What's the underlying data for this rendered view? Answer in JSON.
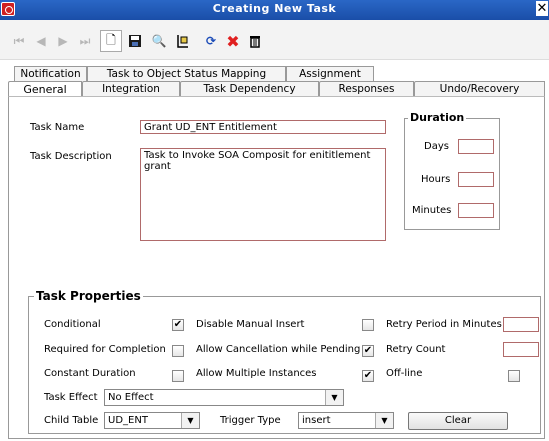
{
  "window": {
    "title": "Creating New Task",
    "app_icon": "oracle-app-icon",
    "close_icon": "close-icon"
  },
  "toolbar": {
    "first": "⏮",
    "prev": "◀",
    "next": "▶",
    "last": "⏭",
    "new": "🗋",
    "save": "💾",
    "find": "🔍",
    "copy": "⎘",
    "refresh": "⟳",
    "delete": "✖",
    "trash": "🗑"
  },
  "tabs": {
    "row1": [
      "Notification",
      "Task to Object Status Mapping",
      "Assignment"
    ],
    "row2": [
      "General",
      "Integration",
      "Task Dependency",
      "Responses",
      "Undo/Recovery"
    ],
    "active": "General"
  },
  "general": {
    "task_name_label": "Task Name",
    "task_name_value": "Grant UD_ENT Entitlement",
    "task_description_label": "Task Description",
    "task_description_value": "Task to Invoke SOA Composit for enititlement grant",
    "duration": {
      "title": "Duration",
      "days_label": "Days",
      "hours_label": "Hours",
      "minutes_label": "Minutes",
      "days_value": "",
      "hours_value": "",
      "minutes_value": ""
    }
  },
  "task_properties": {
    "title": "Task Properties",
    "conditional_label": "Conditional",
    "conditional_checked": "✔",
    "required_for_completion_label": "Required for Completion",
    "required_for_completion_checked": "",
    "constant_duration_label": "Constant Duration",
    "constant_duration_checked": "",
    "disable_manual_insert_label": "Disable Manual Insert",
    "disable_manual_insert_checked": "",
    "allow_cancellation_label": "Allow Cancellation while Pending",
    "allow_cancellation_checked": "✔",
    "allow_multiple_label": "Allow Multiple Instances",
    "allow_multiple_checked": "✔",
    "retry_period_label": "Retry Period in Minutes",
    "retry_period_value": "",
    "retry_count_label": "Retry Count",
    "retry_count_value": "",
    "offline_label": "Off-line",
    "offline_checked": "",
    "task_effect_label": "Task Effect",
    "task_effect_value": "No Effect",
    "child_table_label": "Child Table",
    "child_table_value": "UD_ENT",
    "trigger_type_label": "Trigger Type",
    "trigger_type_value": "insert",
    "clear_label": "Clear"
  }
}
